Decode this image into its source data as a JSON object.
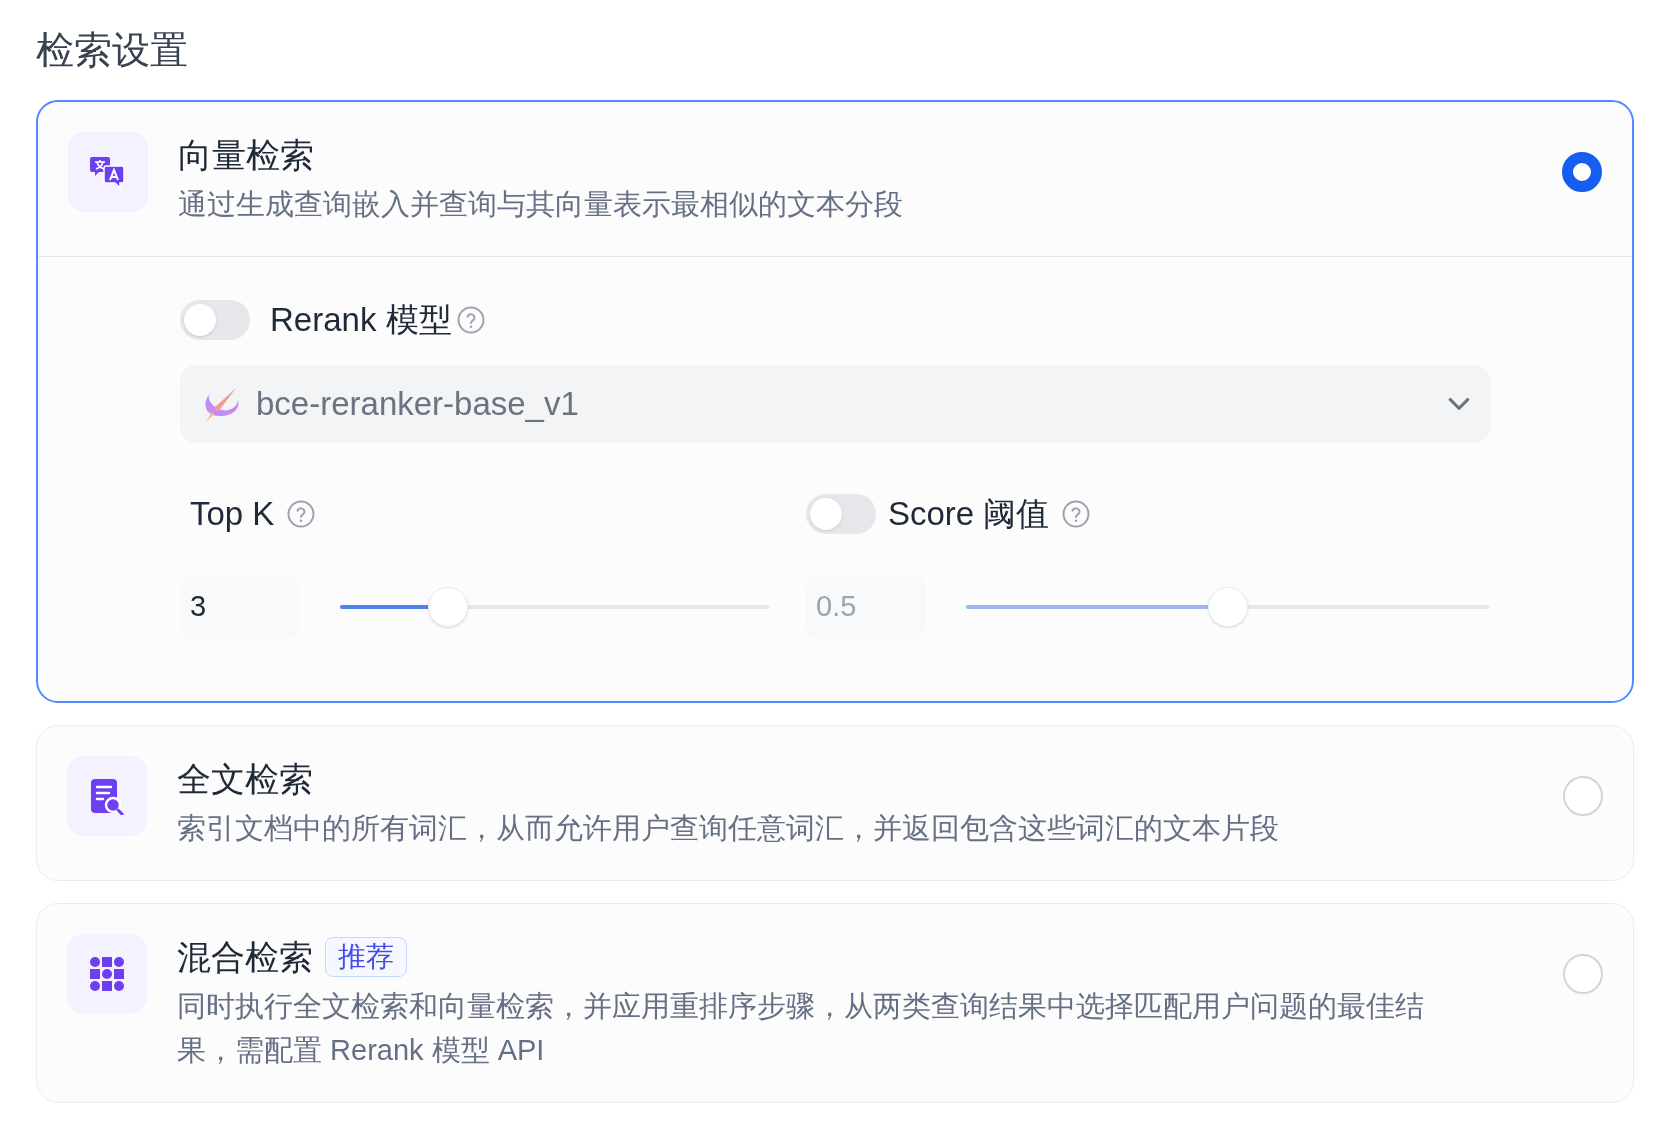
{
  "title": "检索设置",
  "options": [
    {
      "kind": "vector",
      "title": "向量检索",
      "description": "通过生成查询嵌入并查询与其向量表示最相似的文本分段",
      "selected": true,
      "settings": {
        "rerank": {
          "on": false,
          "label": "Rerank 模型",
          "model": "bce-reranker-base_v1"
        },
        "top_k": {
          "label": "Top K",
          "value": "3",
          "level": 0.25
        },
        "score": {
          "on": false,
          "label": "Score 阈值",
          "value": "0.5",
          "level": 0.5,
          "disabled": true
        }
      }
    },
    {
      "kind": "fulltext",
      "title": "全文检索",
      "description": "索引文档中的所有词汇，从而允许用户查询任意词汇，并返回包含这些词汇的文本片段",
      "selected": false
    },
    {
      "kind": "hybrid",
      "title": "混合检索",
      "badge": "推荐",
      "description": "同时执行全文检索和向量检索，并应用重排序步骤，从两类查询结果中选择匹配用户问题的最佳结果，需配置 Rerank 模型 API",
      "selected": false
    }
  ]
}
